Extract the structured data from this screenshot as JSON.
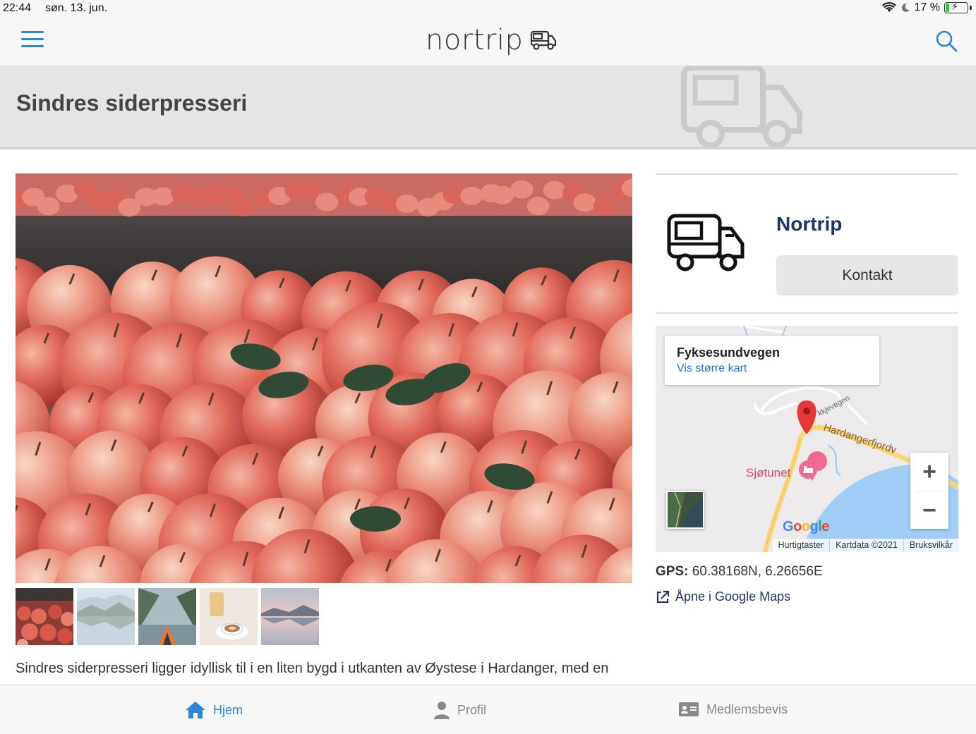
{
  "status_bar": {
    "time": "22:44",
    "date": "søn. 13. jun.",
    "battery_percent": "17 %",
    "battery_level": 0.17
  },
  "header": {
    "logo_text": "nortrip",
    "menu_icon": "hamburger-menu-icon",
    "search_icon": "search-icon"
  },
  "page": {
    "title": "Sindres siderpresseri",
    "description": "Sindres siderpresseri ligger idyllisk til i en liten bygd i utkanten av Øystese i Hardanger, med en"
  },
  "gallery": {
    "thumbnails": [
      "apples",
      "lake-reflection",
      "fjord-kayak",
      "cider-coffee",
      "lake-dusk"
    ]
  },
  "provider": {
    "name": "Nortrip",
    "contact_label": "Kontakt"
  },
  "map": {
    "place_name": "Fyksesundvegen",
    "larger_map_link": "Vis større kart",
    "label_fjord": "Hardangerfjordv",
    "label_poi": "Sjøtunet",
    "label_small_road": "kkjevegen",
    "zoom_in": "+",
    "zoom_out": "−",
    "google_logo": "Google",
    "footer": {
      "shortcuts": "Hurtigtaster",
      "map_data": "Kartdata ©2021",
      "terms": "Bruksvilkår"
    },
    "colors": {
      "water": "#9fcdf5",
      "road": "#f7d774",
      "pin": "#e53935"
    }
  },
  "location": {
    "gps_label": "GPS:",
    "gps_value": "60.38168N, 6.26656E",
    "open_maps_label": "Åpne i Google Maps"
  },
  "bottom_nav": {
    "home": "Hjem",
    "profile": "Profil",
    "membership": "Medlemsbevis"
  },
  "colors": {
    "accent": "#2b87d9",
    "brand_dark": "#1d3566"
  }
}
